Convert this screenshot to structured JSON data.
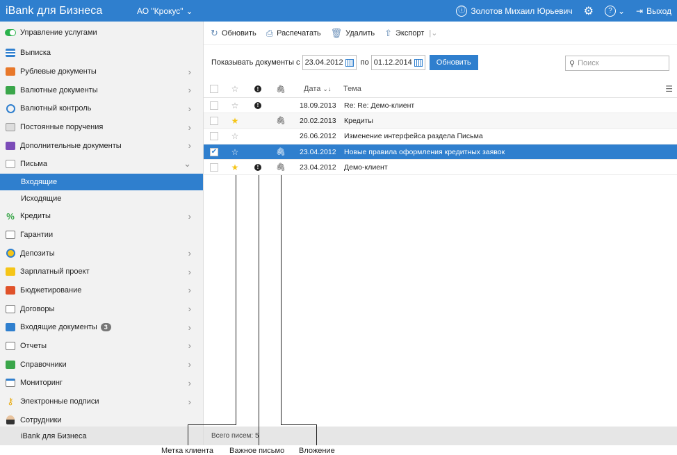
{
  "app": {
    "brand": "iBank для Бизнеса",
    "org": "АО \"Крокус\"",
    "user": "Золотов Михаил Юрьевич",
    "exit": "Выход"
  },
  "sidebar": {
    "items": [
      {
        "label": "Управление услугами",
        "icon": "toggle-icon",
        "chev": false
      },
      {
        "label": "Выписка",
        "icon": "statement-icon",
        "chev": false
      },
      {
        "label": "Рублевые документы",
        "icon": "ruble-doc-icon",
        "chev": true
      },
      {
        "label": "Валютные документы",
        "icon": "currency-doc-icon",
        "chev": true
      },
      {
        "label": "Валютный контроль",
        "icon": "currency-control-icon",
        "chev": true
      },
      {
        "label": "Постоянные поручения",
        "icon": "standing-order-icon",
        "chev": true
      },
      {
        "label": "Дополнительные документы",
        "icon": "add-doc-icon",
        "chev": true
      },
      {
        "label": "Письма",
        "icon": "letter-icon",
        "chev": "down"
      }
    ],
    "subitems": [
      {
        "label": "Входящие",
        "active": true
      },
      {
        "label": "Исходящие",
        "active": false
      }
    ],
    "items2": [
      {
        "label": "Кредиты",
        "icon": "percent-icon",
        "chev": true
      },
      {
        "label": "Гарантии",
        "icon": "guarantee-icon",
        "chev": false
      },
      {
        "label": "Депозиты",
        "icon": "deposit-icon",
        "chev": true
      },
      {
        "label": "Зарплатный проект",
        "icon": "wallet-icon",
        "chev": true
      },
      {
        "label": "Бюджетирование",
        "icon": "briefcase-icon",
        "chev": true
      },
      {
        "label": "Договоры",
        "icon": "contract-icon",
        "chev": true
      },
      {
        "label": "Входящие документы",
        "icon": "incoming-doc-icon",
        "chev": true,
        "badge": "3"
      },
      {
        "label": "Отчеты",
        "icon": "report-icon",
        "chev": true
      },
      {
        "label": "Справочники",
        "icon": "directory-icon",
        "chev": true
      },
      {
        "label": "Мониторинг",
        "icon": "monitoring-icon",
        "chev": true
      },
      {
        "label": "Электронные подписи",
        "icon": "key-icon",
        "chev": true
      },
      {
        "label": "Сотрудники",
        "icon": "employee-icon",
        "chev": false
      }
    ],
    "footer": "iBank для Бизнеса"
  },
  "toolbar": {
    "refresh": "Обновить",
    "print": "Распечатать",
    "delete": "Удалить",
    "export": "Экспорт"
  },
  "filter": {
    "label": "Показывать документы с",
    "date_from": "23.04.2012",
    "to_label": "по",
    "date_to": "01.12.2014",
    "button": "Обновить",
    "search_placeholder": "Поиск"
  },
  "table": {
    "col_date": "Дата",
    "col_topic": "Тема",
    "rows": [
      {
        "checked": false,
        "starred": false,
        "important": true,
        "attachment": false,
        "date": "18.09.2013",
        "topic": "Re: Re: Демо-клиент",
        "selected": false
      },
      {
        "checked": false,
        "starred": true,
        "important": false,
        "attachment": true,
        "date": "20.02.2013",
        "topic": "Кредиты",
        "selected": false
      },
      {
        "checked": false,
        "starred": false,
        "important": false,
        "attachment": false,
        "date": "26.06.2012",
        "topic": "Изменение интерфейса раздела Письма",
        "selected": false
      },
      {
        "checked": true,
        "starred": false,
        "important": false,
        "attachment": true,
        "date": "23.04.2012",
        "topic": "Новые правила оформления кредитных заявок",
        "selected": true
      },
      {
        "checked": false,
        "starred": true,
        "important": true,
        "attachment": true,
        "date": "23.04.2012",
        "topic": "Демо-клиент",
        "selected": false
      }
    ]
  },
  "status": {
    "total": "Всего писем: 5"
  },
  "callouts": {
    "client_mark": "Метка клиента",
    "important": "Важное письмо",
    "attachment": "Вложение"
  }
}
